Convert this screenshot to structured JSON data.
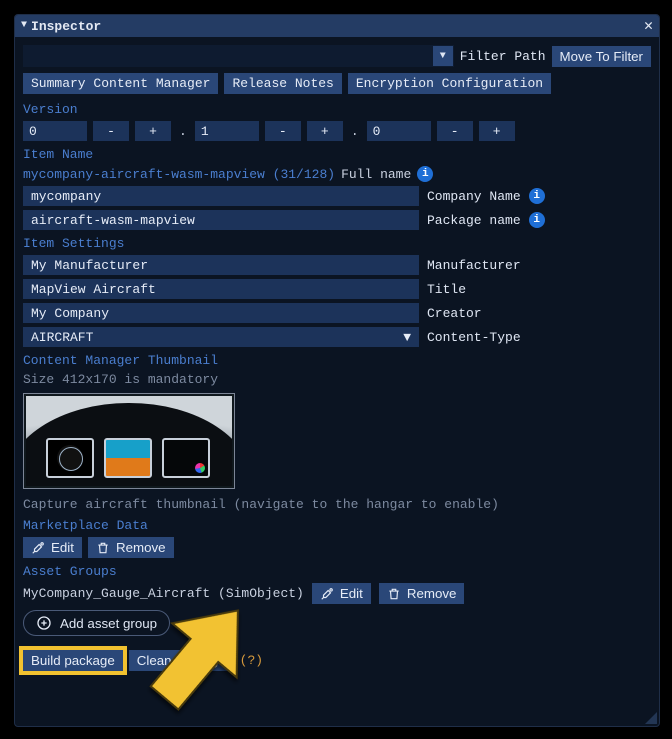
{
  "window": {
    "title": "Inspector"
  },
  "filter": {
    "path_label": "Filter Path",
    "move_btn": "Move To Filter"
  },
  "tabs": {
    "summary": "Summary Content Manager",
    "release": "Release Notes",
    "encryption": "Encryption Configuration"
  },
  "version": {
    "label": "Version",
    "v0": "0",
    "v1": "1",
    "v2": "0",
    "minus": "-",
    "plus": "+",
    "dot": "."
  },
  "item_name": {
    "label": "Item Name",
    "slug": "mycompany-aircraft-wasm-mapview (31/128)",
    "full_name": "Full name",
    "company_value": "mycompany",
    "company_label": "Company Name",
    "package_value": "aircraft-wasm-mapview",
    "package_label": "Package name"
  },
  "item_settings": {
    "label": "Item Settings",
    "manufacturer_value": "My Manufacturer",
    "manufacturer_label": "Manufacturer",
    "title_value": "MapView   Aircraft",
    "title_label": "Title",
    "creator_value": "My Company",
    "creator_label": "Creator",
    "content_type_value": "AIRCRAFT",
    "content_type_label": "Content-Type"
  },
  "thumbnail": {
    "label": "Content Manager Thumbnail",
    "size_hint": "Size 412x170 is mandatory",
    "capture_hint": "Capture aircraft thumbnail (navigate to the hangar to enable)"
  },
  "marketplace": {
    "label": "Marketplace Data",
    "edit": "Edit",
    "remove": "Remove"
  },
  "asset_groups": {
    "label": "Asset Groups",
    "group_name": "MyCompany_Gauge_Aircraft (SimObject)",
    "edit": "Edit",
    "remove": "Remove",
    "add": "Add asset group"
  },
  "footer": {
    "build": "Build package",
    "clean": "Clean package",
    "help": "(?)"
  }
}
